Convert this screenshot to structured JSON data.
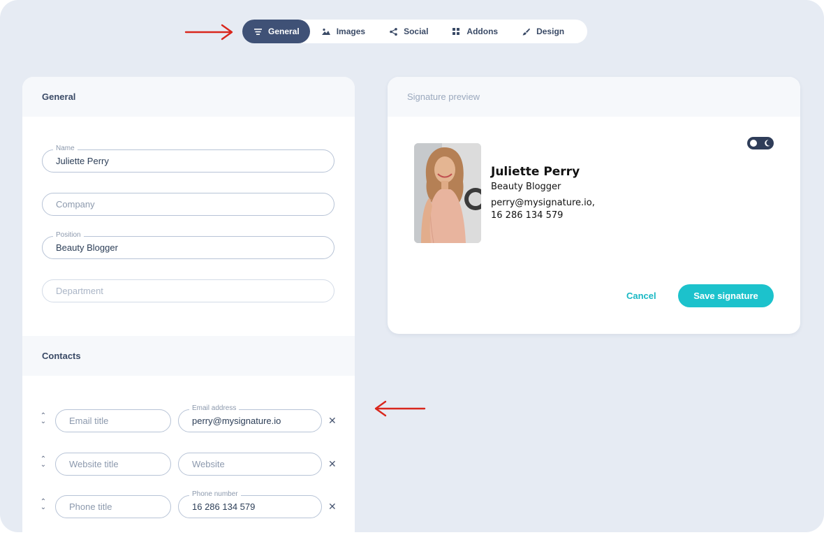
{
  "tabs": [
    {
      "label": "General",
      "icon": "lines-icon",
      "active": true
    },
    {
      "label": "Images",
      "icon": "image-icon",
      "active": false
    },
    {
      "label": "Social",
      "icon": "share-icon",
      "active": false
    },
    {
      "label": "Addons",
      "icon": "grid-icon",
      "active": false
    },
    {
      "label": "Design",
      "icon": "brush-icon",
      "active": false
    }
  ],
  "general": {
    "title": "General",
    "name": {
      "label": "Name",
      "value": "Juliette Perry"
    },
    "company": {
      "placeholder": "Company"
    },
    "position": {
      "label": "Position",
      "value": "Beauty Blogger"
    },
    "department": {
      "placeholder": "Department"
    }
  },
  "contacts": {
    "title": "Contacts",
    "email": {
      "title_placeholder": "Email title",
      "label": "Email address",
      "value": "perry@mysignature.io"
    },
    "website": {
      "title_placeholder": "Website title",
      "placeholder": "Website"
    },
    "phone": {
      "title_placeholder": "Phone title",
      "label": "Phone number",
      "value": "16 286 134 579"
    },
    "remove_glyph": "✕"
  },
  "preview": {
    "title": "Signature preview",
    "name": "Juliette Perry",
    "position": "Beauty Blogger",
    "email": "perry@mysignature.io,",
    "phone": "16 286 134 579",
    "cancel_label": "Cancel",
    "save_label": "Save signature"
  },
  "colors": {
    "accent": "#1cc2cc",
    "active_tab": "#3f5176",
    "arrow": "#d9261c",
    "background": "#e6ebf3"
  }
}
